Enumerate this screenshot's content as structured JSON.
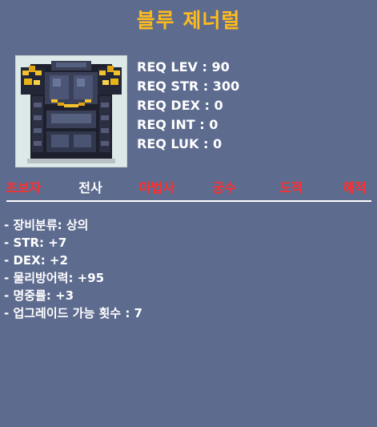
{
  "item": {
    "name": "블루 제너럴",
    "icon": "armor-icon"
  },
  "requirements": [
    "REQ LEV : 90",
    "REQ STR : 300",
    "REQ DEX : 0",
    "REQ INT : 0",
    "REQ LUK : 0"
  ],
  "jobs": [
    {
      "label": "초보자",
      "color": "#ff2f2f"
    },
    {
      "label": "전사",
      "color": "#ffffff"
    },
    {
      "label": "마법사",
      "color": "#ff2f2f"
    },
    {
      "label": "궁수",
      "color": "#ff2f2f"
    },
    {
      "label": "도적",
      "color": "#ff2f2f"
    },
    {
      "label": "해적",
      "color": "#ff2f2f"
    }
  ],
  "stats": [
    "- 장비분류: 상의",
    "- STR: +7",
    "- DEX: +2",
    "- 물리방어력: +95",
    "- 명중률: +3",
    "- 업그레이드 가능 횟수 : 7"
  ],
  "colors": {
    "background": "#5d6b8f",
    "title": "#ffbb1c",
    "job_available": "#ffffff",
    "job_unavailable": "#ff2f2f"
  }
}
